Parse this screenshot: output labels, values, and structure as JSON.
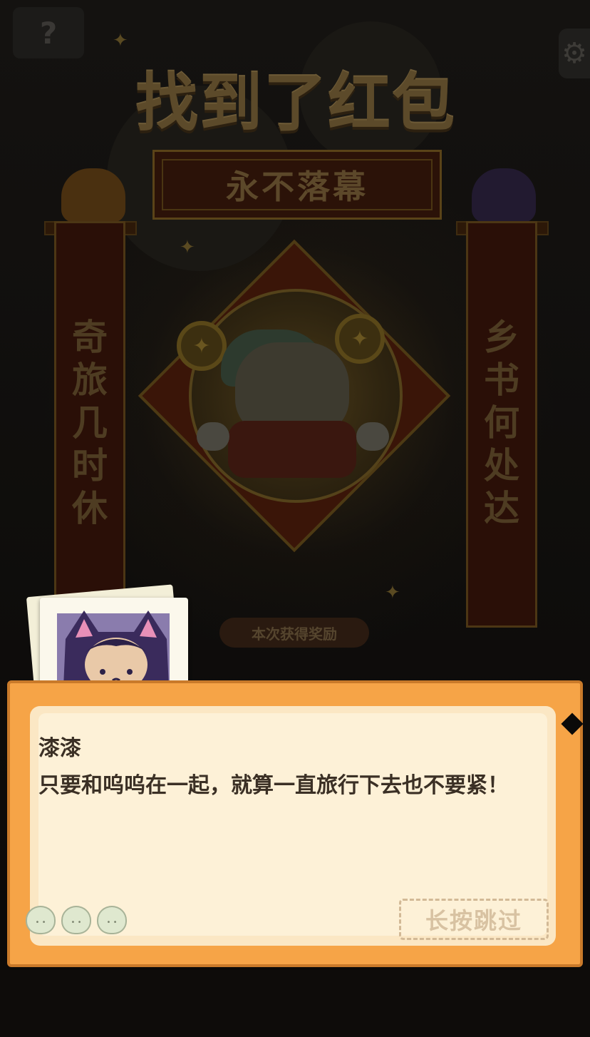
{
  "help_button": "?",
  "title": "找到了红包",
  "banner": "永不落幕",
  "couplet_left": [
    "奇",
    "旅",
    "几",
    "时",
    "休"
  ],
  "couplet_right": [
    "乡",
    "书",
    "何",
    "处",
    "达"
  ],
  "reward_label": "本次获得奖励",
  "dialog": {
    "speaker": "漆漆",
    "text": "只要和呜呜在一起，就算一直旅行下去也不要紧！",
    "skip_label": "长按跳过"
  },
  "colors": {
    "dialog_frame": "#f6a447",
    "dialog_paper": "#fdf1d7",
    "dialog_text": "#3b3025"
  },
  "icons": {
    "help": "question-mark-icon",
    "settings": "gear-icon"
  }
}
